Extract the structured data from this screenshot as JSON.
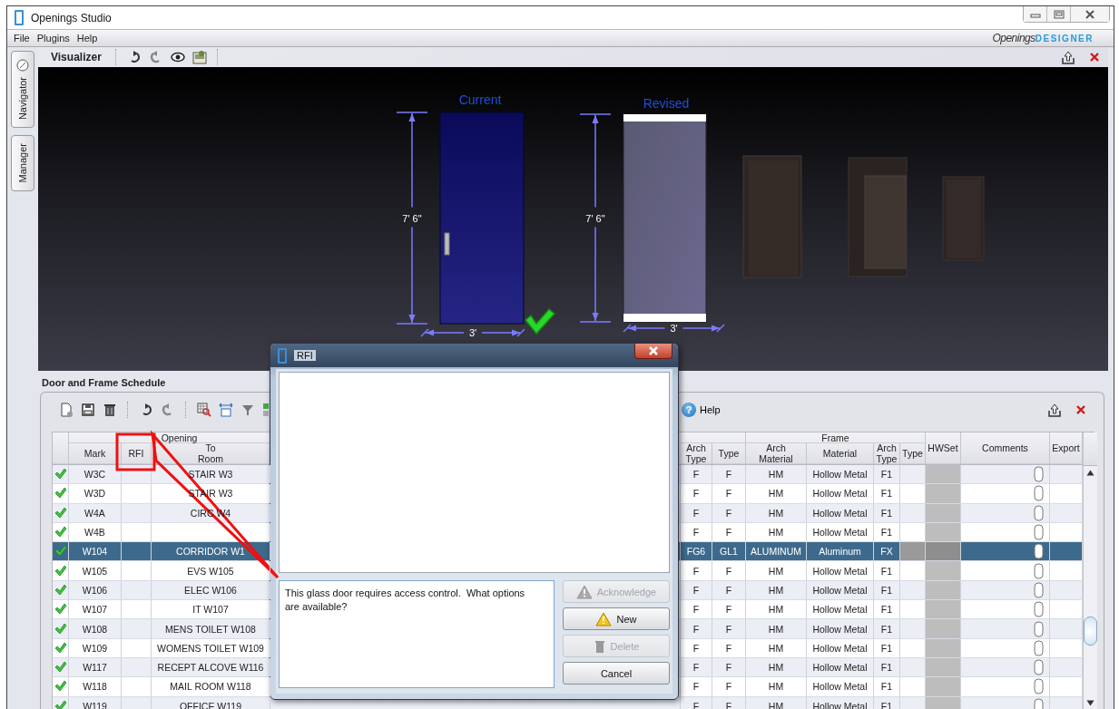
{
  "window": {
    "title": "Openings Studio"
  },
  "menu": [
    "File",
    "Plugins",
    "Help"
  ],
  "logo": {
    "wordmark": "Openings",
    "subtitle": "DESIGNER"
  },
  "side_tabs": [
    {
      "label": "Navigator",
      "has_icon": true
    },
    {
      "label": "Manager",
      "has_icon": false
    }
  ],
  "visualizer": {
    "title": "Visualizer",
    "current": {
      "label": "Current",
      "height": "7' 6\"",
      "width": "3'",
      "approved": true
    },
    "revised": {
      "label": "Revised",
      "height": "7' 6\"",
      "width": "3'"
    }
  },
  "schedule": {
    "title": "Door and Frame Schedule",
    "help": {
      "icon": "?",
      "label": "Help"
    },
    "column_groups": [
      {
        "label": "Opening"
      },
      {
        "label": "Frame"
      }
    ],
    "columns": [
      {
        "label": "Mark"
      },
      {
        "label": "RFI"
      },
      {
        "label": "To Room"
      },
      {
        "label": "Arch Type"
      },
      {
        "label": "Type"
      },
      {
        "label": "Arch Material"
      },
      {
        "label": "Material"
      },
      {
        "label": "Arch Type"
      },
      {
        "label": "Type"
      },
      {
        "label": "HWSet"
      },
      {
        "label": "Comments"
      },
      {
        "label": "Export"
      }
    ],
    "rows": [
      {
        "approved": true,
        "selected": false,
        "mark": "W3C",
        "to_room": "STAIR W3",
        "arch_type": "F",
        "type": "F",
        "frame_arch_material": "HM",
        "frame_material": "Hollow Metal",
        "frame_arch_type": "F1"
      },
      {
        "approved": true,
        "selected": false,
        "mark": "W3D",
        "to_room": "STAIR W3",
        "arch_type": "F",
        "type": "F",
        "frame_arch_material": "HM",
        "frame_material": "Hollow Metal",
        "frame_arch_type": "F1"
      },
      {
        "approved": true,
        "selected": false,
        "mark": "W4A",
        "to_room": "CIRC W4",
        "arch_type": "F",
        "type": "F",
        "frame_arch_material": "HM",
        "frame_material": "Hollow Metal",
        "frame_arch_type": "F1"
      },
      {
        "approved": true,
        "selected": false,
        "mark": "W4B",
        "arch_type": "F",
        "type": "F",
        "frame_arch_material": "HM",
        "frame_material": "Hollow Metal",
        "frame_arch_type": "F1"
      },
      {
        "approved": true,
        "selected": true,
        "mark": "W104",
        "to_room": "CORRIDOR W1",
        "arch_type": "FG6",
        "type": "GL1",
        "frame_arch_material": "ALUMINUM",
        "frame_material": "Aluminum",
        "frame_arch_type": "FX"
      },
      {
        "approved": true,
        "selected": false,
        "mark": "W105",
        "to_room": "EVS W105",
        "arch_type": "F",
        "type": "F",
        "frame_arch_material": "HM",
        "frame_material": "Hollow Metal",
        "frame_arch_type": "F1"
      },
      {
        "approved": true,
        "selected": false,
        "mark": "W106",
        "to_room": "ELEC W106",
        "arch_type": "F",
        "type": "F",
        "frame_arch_material": "HM",
        "frame_material": "Hollow Metal",
        "frame_arch_type": "F1"
      },
      {
        "approved": true,
        "selected": false,
        "mark": "W107",
        "to_room": "IT W107",
        "arch_type": "F",
        "type": "F",
        "frame_arch_material": "HM",
        "frame_material": "Hollow Metal",
        "frame_arch_type": "F1"
      },
      {
        "approved": true,
        "selected": false,
        "mark": "W108",
        "to_room": "MENS TOILET W108",
        "arch_type": "F",
        "type": "F",
        "frame_arch_material": "HM",
        "frame_material": "Hollow Metal",
        "frame_arch_type": "F1"
      },
      {
        "approved": true,
        "selected": false,
        "mark": "W109",
        "to_room": "WOMENS TOILET W109",
        "arch_type": "F",
        "type": "F",
        "frame_arch_material": "HM",
        "frame_material": "Hollow Metal",
        "frame_arch_type": "F1"
      },
      {
        "approved": true,
        "selected": false,
        "mark": "W117",
        "to_room": "RECEPT ALCOVE W116",
        "arch_type": "F",
        "type": "F",
        "frame_arch_material": "HM",
        "frame_material": "Hollow Metal",
        "frame_arch_type": "F1"
      },
      {
        "approved": true,
        "selected": false,
        "mark": "W118",
        "to_room": "MAIL ROOM W118",
        "arch_type": "F",
        "type": "F",
        "frame_arch_material": "HM",
        "frame_material": "Hollow Metal",
        "frame_arch_type": "F1"
      },
      {
        "approved": true,
        "selected": false,
        "mark": "W119",
        "to_room": "OFFICE W119",
        "arch_type": "F",
        "type": "F",
        "frame_arch_material": "HM",
        "frame_material": "Hollow Metal",
        "frame_arch_type": "F1"
      }
    ]
  },
  "dialog": {
    "title": "RFI",
    "message": "This glass door requires access control.  What options are available?",
    "buttons": [
      {
        "label": "Acknowledge",
        "kind": "warning",
        "disabled": true
      },
      {
        "label": "New",
        "kind": "warning",
        "disabled": false
      },
      {
        "label": "Delete",
        "kind": "delete",
        "disabled": true
      },
      {
        "label": "Cancel",
        "kind": "plain",
        "disabled": false
      }
    ]
  }
}
